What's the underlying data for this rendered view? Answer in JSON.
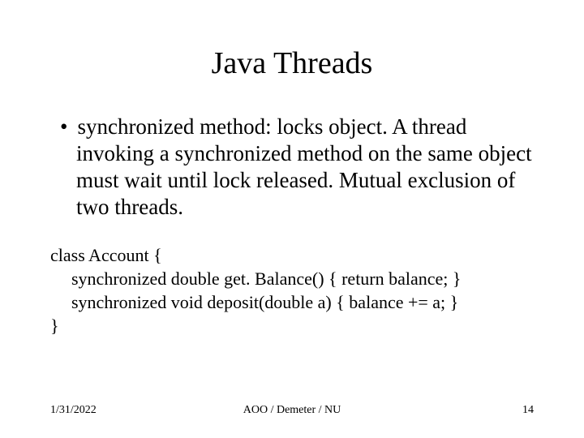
{
  "title": "Java Threads",
  "bullet": "synchronized method: locks object. A thread invoking a synchronized method on the same object must wait until lock released. Mutual exclusion of two threads.",
  "code": {
    "line1": "class Account {",
    "line2": "synchronized double get. Balance() { return balance; }",
    "line3": "synchronized void deposit(double a) { balance += a; }",
    "line4": "}"
  },
  "footer": {
    "date": "1/31/2022",
    "center": "AOO / Demeter / NU",
    "page": "14"
  }
}
